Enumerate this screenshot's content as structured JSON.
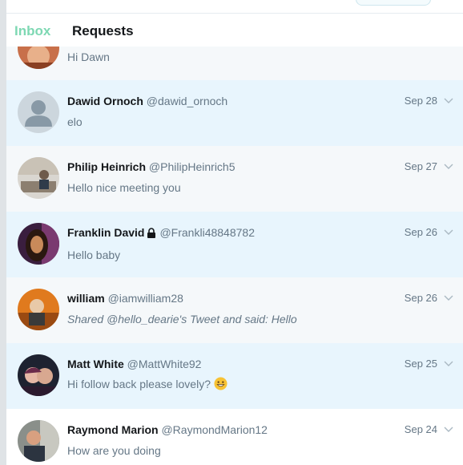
{
  "tabs": {
    "inbox": "Inbox",
    "requests": "Requests"
  },
  "partial": {
    "preview": "Hi Dawn"
  },
  "conversations": [
    {
      "name": "Dawid Ornoch",
      "handle": "@dawid_ornoch",
      "date": "Sep 28",
      "preview": "elo"
    },
    {
      "name": "Philip Heinrich",
      "handle": "@PhilipHeinrich5",
      "date": "Sep 27",
      "preview": "Hello nice meeting you"
    },
    {
      "name": "Franklin David",
      "handle": "@Frankli48848782",
      "date": "Sep 26",
      "preview": "Hello baby",
      "protected": true
    },
    {
      "name": "william",
      "handle": "@iamwilliam28",
      "date": "Sep 26",
      "preview": "Shared @hello_dearie's Tweet and said: Hello"
    },
    {
      "name": "Matt White",
      "handle": "@MattWhite92",
      "date": "Sep 25",
      "preview": "Hi follow back please lovely?",
      "emoji": "grinning-face"
    },
    {
      "name": "Raymond Marion",
      "handle": "@RaymondMarion12",
      "date": "Sep 24",
      "preview": "How are you doing"
    }
  ],
  "colors": {
    "inbox_tab": "#7ed8b3",
    "highlight_row": "#e8f5fd",
    "secondary_text": "#657786"
  }
}
